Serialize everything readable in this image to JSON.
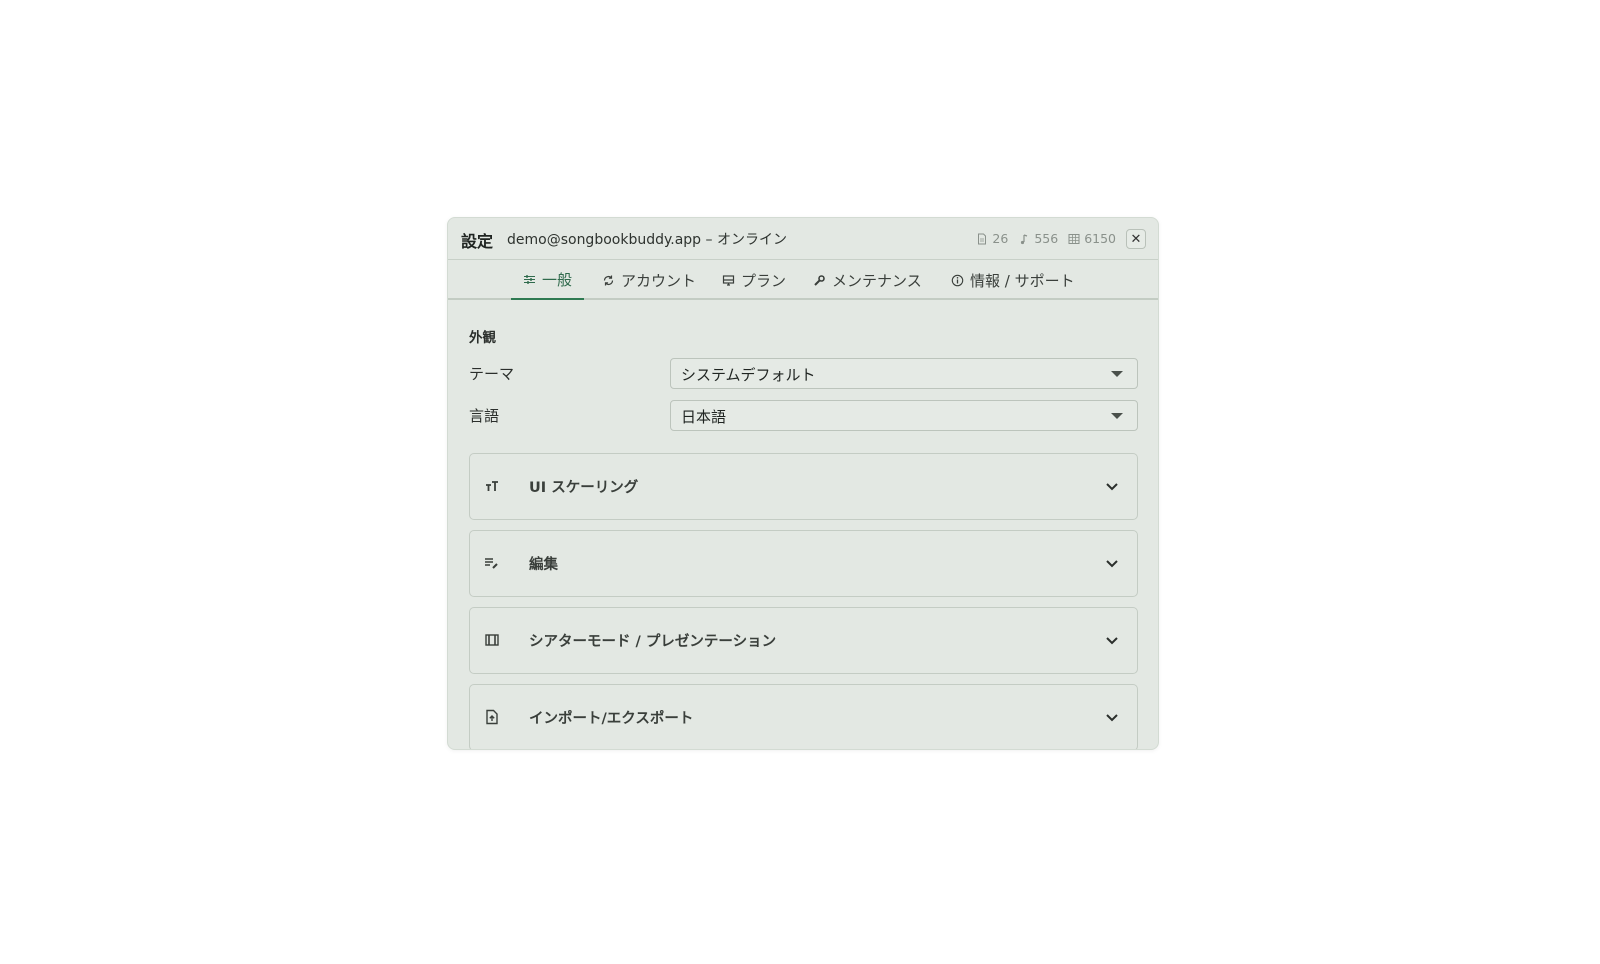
{
  "dialog": {
    "title": "設定",
    "subtitle": "demo@songbookbuddy.app – オンライン",
    "stats": [
      {
        "icon": "document-icon",
        "value": "26"
      },
      {
        "icon": "music-note-icon",
        "value": "556"
      },
      {
        "icon": "grid-icon",
        "value": "6150"
      }
    ],
    "close_label": "✕"
  },
  "tabs": [
    {
      "icon": "sliders-icon",
      "label": "一般",
      "active": true
    },
    {
      "icon": "sync-icon",
      "label": "アカウント",
      "active": false
    },
    {
      "icon": "monitor-icon",
      "label": "プラン",
      "active": false
    },
    {
      "icon": "wrench-icon",
      "label": "メンテナンス",
      "active": false
    },
    {
      "icon": "info-icon",
      "label": "情報 / サポート",
      "active": false
    }
  ],
  "appearance": {
    "heading": "外観",
    "theme_label": "テーマ",
    "theme_value": "システムデフォルト",
    "language_label": "言語",
    "language_value": "日本語"
  },
  "panels": [
    {
      "icon": "text-size-icon",
      "label": "UI スケーリング"
    },
    {
      "icon": "edit-list-icon",
      "label": "編集"
    },
    {
      "icon": "theater-icon",
      "label": "シアターモード / プレゼンテーション"
    },
    {
      "icon": "file-import-icon",
      "label": "インポート/エクスポート"
    }
  ],
  "colors": {
    "accent": "#2f7a52",
    "dialog_bg": "#e3e8e3"
  }
}
